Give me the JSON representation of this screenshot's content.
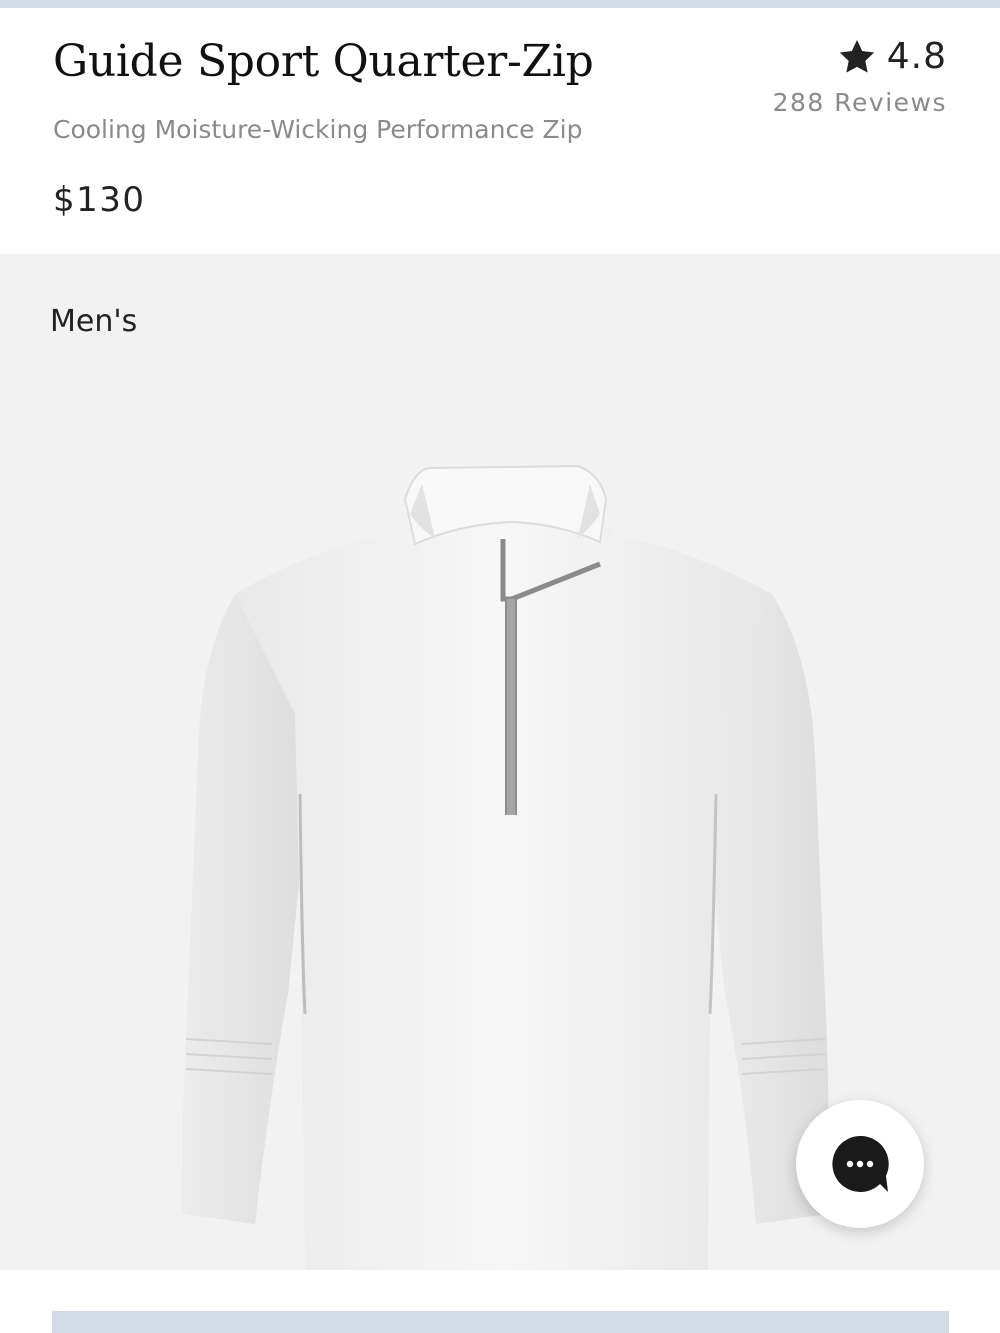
{
  "product": {
    "title": "Guide Sport Quarter-Zip",
    "subtitle": "Cooling Moisture-Wicking Performance Zip",
    "price": "$130"
  },
  "rating": {
    "value": "4.8",
    "reviews": "288 Reviews",
    "icon": "star-icon"
  },
  "gallery": {
    "gender": "Men's",
    "image_icon": "white-quarter-zip-shirt-image"
  },
  "chat": {
    "icon": "chat-bubble-icon"
  },
  "colors": {
    "accent_strip": "#d3dbe5",
    "image_background": "#f2f2f2",
    "chat_bubble": "#1a1a1a"
  }
}
